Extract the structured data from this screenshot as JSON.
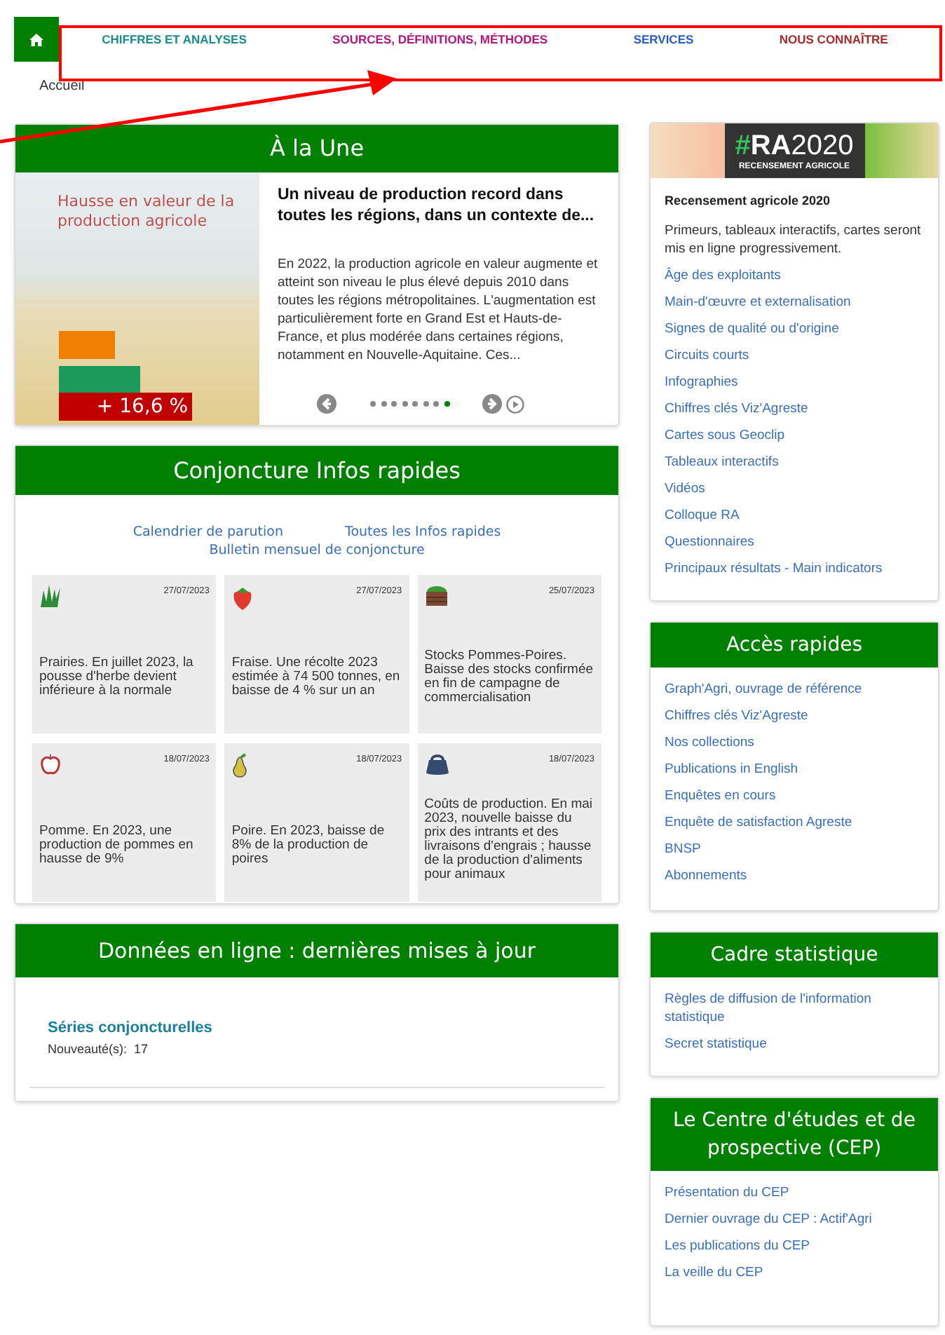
{
  "nav": {
    "items": [
      {
        "label": "CHIFFRES ET ANALYSES",
        "color": "#1a8a8a"
      },
      {
        "label": "SOURCES, DÉFINITIONS, MÉTHODES",
        "color": "#b0167e"
      },
      {
        "label": "SERVICES",
        "color": "#2a5cc8"
      },
      {
        "label": "NOUS CONNAÎTRE",
        "color": "#a52a2a"
      }
    ]
  },
  "breadcrumb": "Accueil",
  "une": {
    "title": "À la Une",
    "image_caption": "Hausse en valeur de la production agricole",
    "image_value": "+ 16,6 %",
    "headline": "Un niveau de production record dans toutes les régions, dans un contexte de...",
    "summary": "En 2022, la production agricole en valeur augmente et atteint son niveau le plus élevé depuis 2010 dans toutes les régions métropolitaines. L'augmentation est particulièrement forte en Grand Est et Hauts-de-France, et plus modérée dans certaines régions, notamment en Nouvelle-Aquitaine. Ces...",
    "slides": [
      {
        "selected": false
      },
      {
        "selected": false
      },
      {
        "selected": false
      },
      {
        "selected": false
      },
      {
        "selected": false
      },
      {
        "selected": false
      },
      {
        "selected": false
      },
      {
        "selected": true
      }
    ]
  },
  "conjoncture": {
    "title": "Conjoncture Infos rapides",
    "links": [
      "Calendrier de parution",
      "Toutes les Infos rapides",
      "Bulletin mensuel de conjoncture"
    ],
    "cards": [
      {
        "kind": "grass",
        "date": "27/07/2023",
        "text": "Prairies. En juillet 2023, la pousse d'herbe devient inférieure à la normale"
      },
      {
        "kind": "strawberry",
        "date": "27/07/2023",
        "text": "Fraise. Une récolte 2023 estimée à 74 500 tonnes, en baisse de 4 % sur un an"
      },
      {
        "kind": "crate",
        "date": "25/07/2023",
        "text": "Stocks Pommes-Poires. Baisse des stocks confirmée en fin de campagne de commercialisation"
      },
      {
        "kind": "apple",
        "date": "18/07/2023",
        "text": "Pomme. En 2023, une production de pommes en hausse de 9%"
      },
      {
        "kind": "pear",
        "date": "18/07/2023",
        "text": "Poire. En 2023, baisse de 8% de la production de poires"
      },
      {
        "kind": "bag",
        "date": "18/07/2023",
        "text": "Coûts de production. En mai 2023, nouvelle baisse du prix des intrants et des livraisons d'engrais ; hausse de la production d'aliments pour animaux"
      }
    ]
  },
  "donnees": {
    "title": "Données en ligne : dernières mises à jour",
    "series": "Séries conjoncturelles",
    "count": "Nouveauté(s):  17"
  },
  "ra": {
    "banner_hash": "#",
    "banner_ra": "RA",
    "banner_year": "2020",
    "banner_sub": "RECENSEMENT AGRICOLE",
    "title": "Recensement agricole 2020",
    "intro": "Primeurs, tableaux interactifs, cartes seront mis en ligne progressivement.",
    "links": [
      "Âge des exploitants",
      "Main-d'œuvre et externalisation",
      "Signes de qualité ou d'origine",
      "Circuits courts",
      "Infographies",
      "Chiffres clés Viz'Agreste",
      "Cartes sous Geoclip",
      "Tableaux interactifs",
      "Vidéos",
      "Colloque RA",
      "Questionnaires",
      "Principaux résultats - Main indicators"
    ]
  },
  "panels": [
    {
      "title": "Accès rapides",
      "links": [
        "Graph'Agri, ouvrage de référence",
        "Chiffres clés Viz'Agreste",
        "Nos collections",
        "Publications in English",
        "Enquêtes en cours",
        "Enquête de satisfaction Agreste",
        "BNSP",
        "Abonnements"
      ]
    },
    {
      "title": "Cadre statistique",
      "links": [
        "Règles de diffusion de l'information statistique",
        "Secret statistique"
      ]
    },
    {
      "title": "Le Centre d'études et de prospective (CEP)",
      "links": [
        "Présentation du CEP",
        "Dernier ouvrage du CEP : Actif'Agri",
        "Les publications du CEP",
        "La veille du CEP"
      ]
    }
  ]
}
